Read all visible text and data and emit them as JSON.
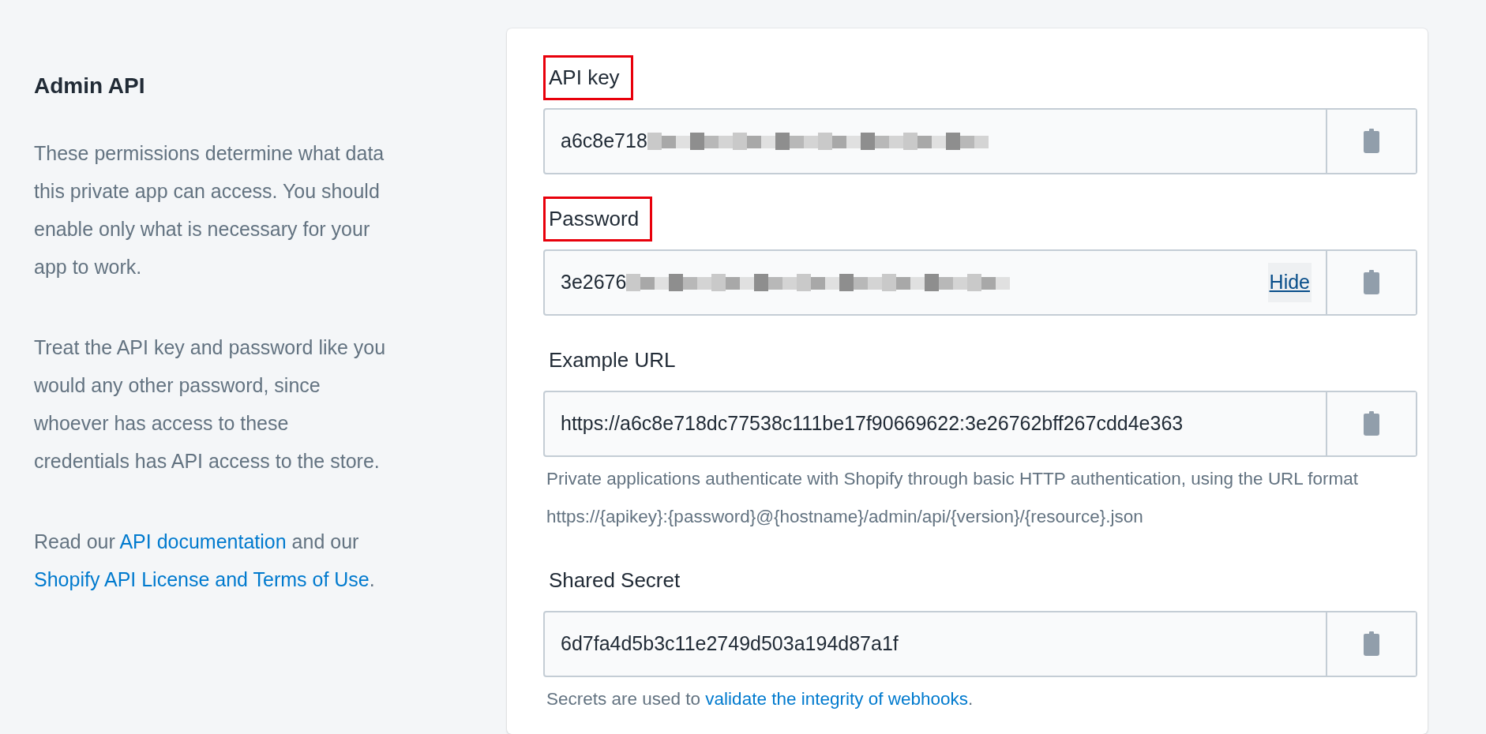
{
  "section": {
    "title": "Admin API",
    "paragraphs": [
      "These permissions determine what data this private app can access. You should enable only what is necessary for your app to work.",
      "Treat the API key and password like you would any other password, since whoever has access to these credentials has API access to the store."
    ],
    "links_paragraph": [
      {
        "kind": "text",
        "text": "Read our "
      },
      {
        "kind": "link",
        "text": "API documentation"
      },
      {
        "kind": "text",
        "text": " and our "
      },
      {
        "kind": "link",
        "text": "Shopify API License and Terms of Use"
      },
      {
        "kind": "text",
        "text": "."
      }
    ]
  },
  "fields": [
    {
      "label": "API key",
      "highlighted": true,
      "value": "a6c8e718",
      "redacted": true
    },
    {
      "label": "Password",
      "highlighted": true,
      "value": "3e2676",
      "redacted": true,
      "toggle": "Hide"
    },
    {
      "label": "Example URL",
      "highlighted": false,
      "value": "https://a6c8e718dc77538c111be17f90669622:3e26762bff267cdd4e363",
      "redacted": false,
      "help": [
        {
          "kind": "text",
          "text": "Private applications authenticate with Shopify through basic HTTP authentication, using the URL format https://{apikey}:{password}@{hostname}/admin/api/{version}/{resource}.json"
        }
      ]
    },
    {
      "label": "Shared Secret",
      "highlighted": false,
      "value": "6d7fa4d5b3c11e2749d503a194d87a1f",
      "redacted": false,
      "help": [
        {
          "kind": "text",
          "text": "Secrets are used to "
        },
        {
          "kind": "link",
          "text": "validate the integrity of webhooks"
        },
        {
          "kind": "text",
          "text": "."
        }
      ]
    }
  ]
}
